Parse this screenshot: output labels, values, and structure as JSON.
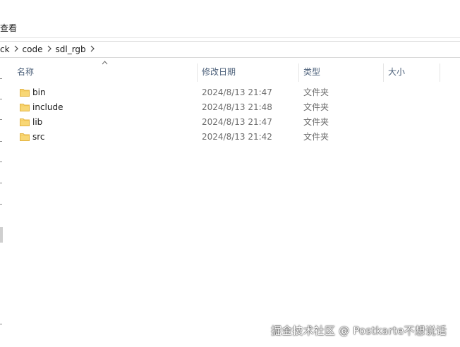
{
  "ribbon": {
    "view_tab": "查看"
  },
  "address": {
    "crumbs": [
      "ck",
      "code",
      "sdl_rgb"
    ],
    "separator_icon": "chevron-right-icon"
  },
  "columns": {
    "name": "名称",
    "modified": "修改日期",
    "type": "类型",
    "size": "大小",
    "sort_indicator": "^"
  },
  "files": [
    {
      "name": "bin",
      "modified": "2024/8/13 21:47",
      "type": "文件夹",
      "icon": "folder-icon"
    },
    {
      "name": "include",
      "modified": "2024/8/13 21:48",
      "type": "文件夹",
      "icon": "folder-icon"
    },
    {
      "name": "lib",
      "modified": "2024/8/13 21:47",
      "type": "文件夹",
      "icon": "folder-icon"
    },
    {
      "name": "src",
      "modified": "2024/8/13 21:42",
      "type": "文件夹",
      "icon": "folder-icon"
    }
  ],
  "watermark": "掘金技术社区 @ Postkarte不想说话",
  "colors": {
    "header_text": "#4c607a",
    "folder_fill": "#f8d775",
    "folder_edge": "#e3b341"
  }
}
